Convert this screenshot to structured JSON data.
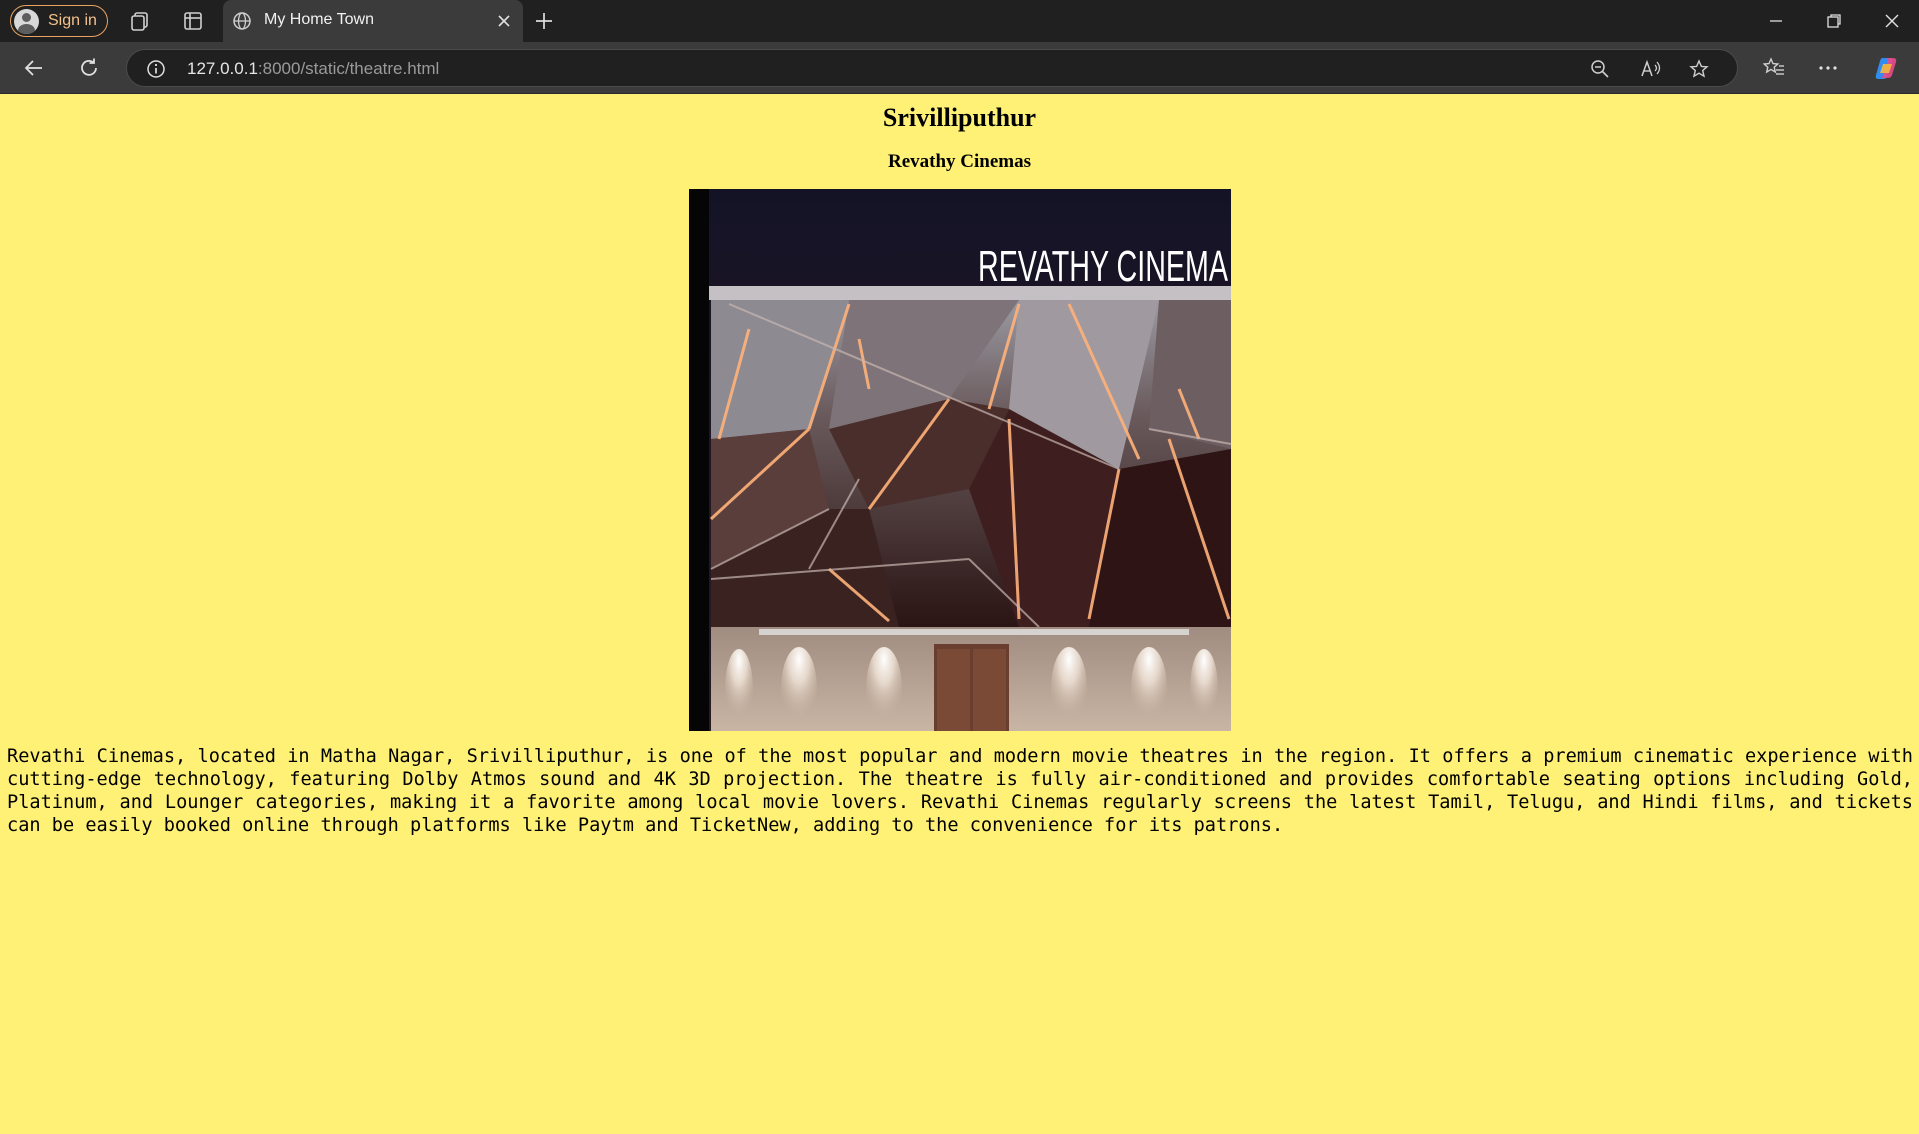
{
  "browser": {
    "signin_label": "Sign in",
    "tab_title": "My Home Town",
    "url_host": "127.0.0.1",
    "url_path": ":8000/static/theatre.html"
  },
  "page": {
    "heading": "Srivilliputhur",
    "subheading": "Revathy Cinemas",
    "image_sign_text": "REVATHY CINEMA",
    "description": "Revathi Cinemas, located in Matha Nagar, Srivilliputhur, is one of the most popular and modern movie theatres in the region. It offers a premium cinematic experience with cutting-edge technology, featuring Dolby Atmos sound and 4K 3D projection. The theatre is fully air-conditioned and provides comfortable seating options including Gold, Platinum, and Lounger categories, making it a favorite among local movie lovers. Revathi Cinemas regularly screens the latest Tamil, Telugu, and Hindi films, and tickets can be easily booked online through platforms like Paytm and TicketNew, adding to the convenience for its patrons."
  },
  "colors": {
    "page_background": "#fff176",
    "chrome_dark": "#202020",
    "chrome_mid": "#3b3b3b",
    "signin_accent": "#e9a25f"
  }
}
